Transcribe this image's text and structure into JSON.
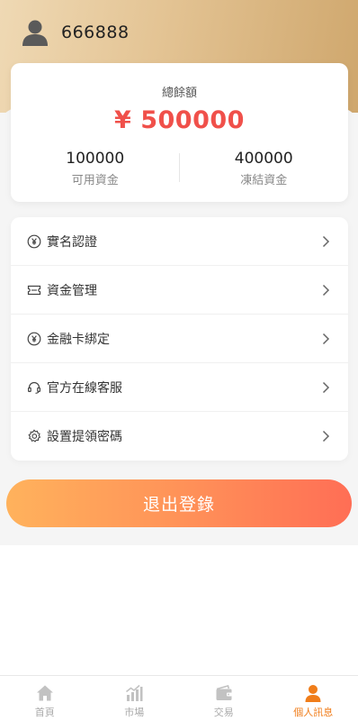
{
  "header": {
    "username": "666888"
  },
  "balance": {
    "title": "總餘額",
    "amount": "¥ 500000",
    "available_value": "100000",
    "available_label": "可用資金",
    "frozen_value": "400000",
    "frozen_label": "凍結資金"
  },
  "menu": {
    "items": [
      {
        "label": "實名認證",
        "icon": "yen-circle-icon"
      },
      {
        "label": "資金管理",
        "icon": "ticket-icon"
      },
      {
        "label": "金融卡綁定",
        "icon": "yen-circle-icon"
      },
      {
        "label": "官方在線客服",
        "icon": "headset-icon"
      },
      {
        "label": "設置提領密碼",
        "icon": "gear-icon"
      }
    ]
  },
  "logout": {
    "label": "退出登錄"
  },
  "tabbar": {
    "tabs": [
      {
        "label": "首頁",
        "icon": "home-icon",
        "active": false
      },
      {
        "label": "市場",
        "icon": "chart-icon",
        "active": false
      },
      {
        "label": "交易",
        "icon": "wallet-icon",
        "active": false
      },
      {
        "label": "個人訊息",
        "icon": "person-icon",
        "active": true
      }
    ]
  },
  "colors": {
    "accent": "#f07d1a",
    "amount_red": "#f0504a",
    "gold": "#d9b27c",
    "logout_start": "#ffb25c",
    "logout_end": "#ff6e55"
  }
}
